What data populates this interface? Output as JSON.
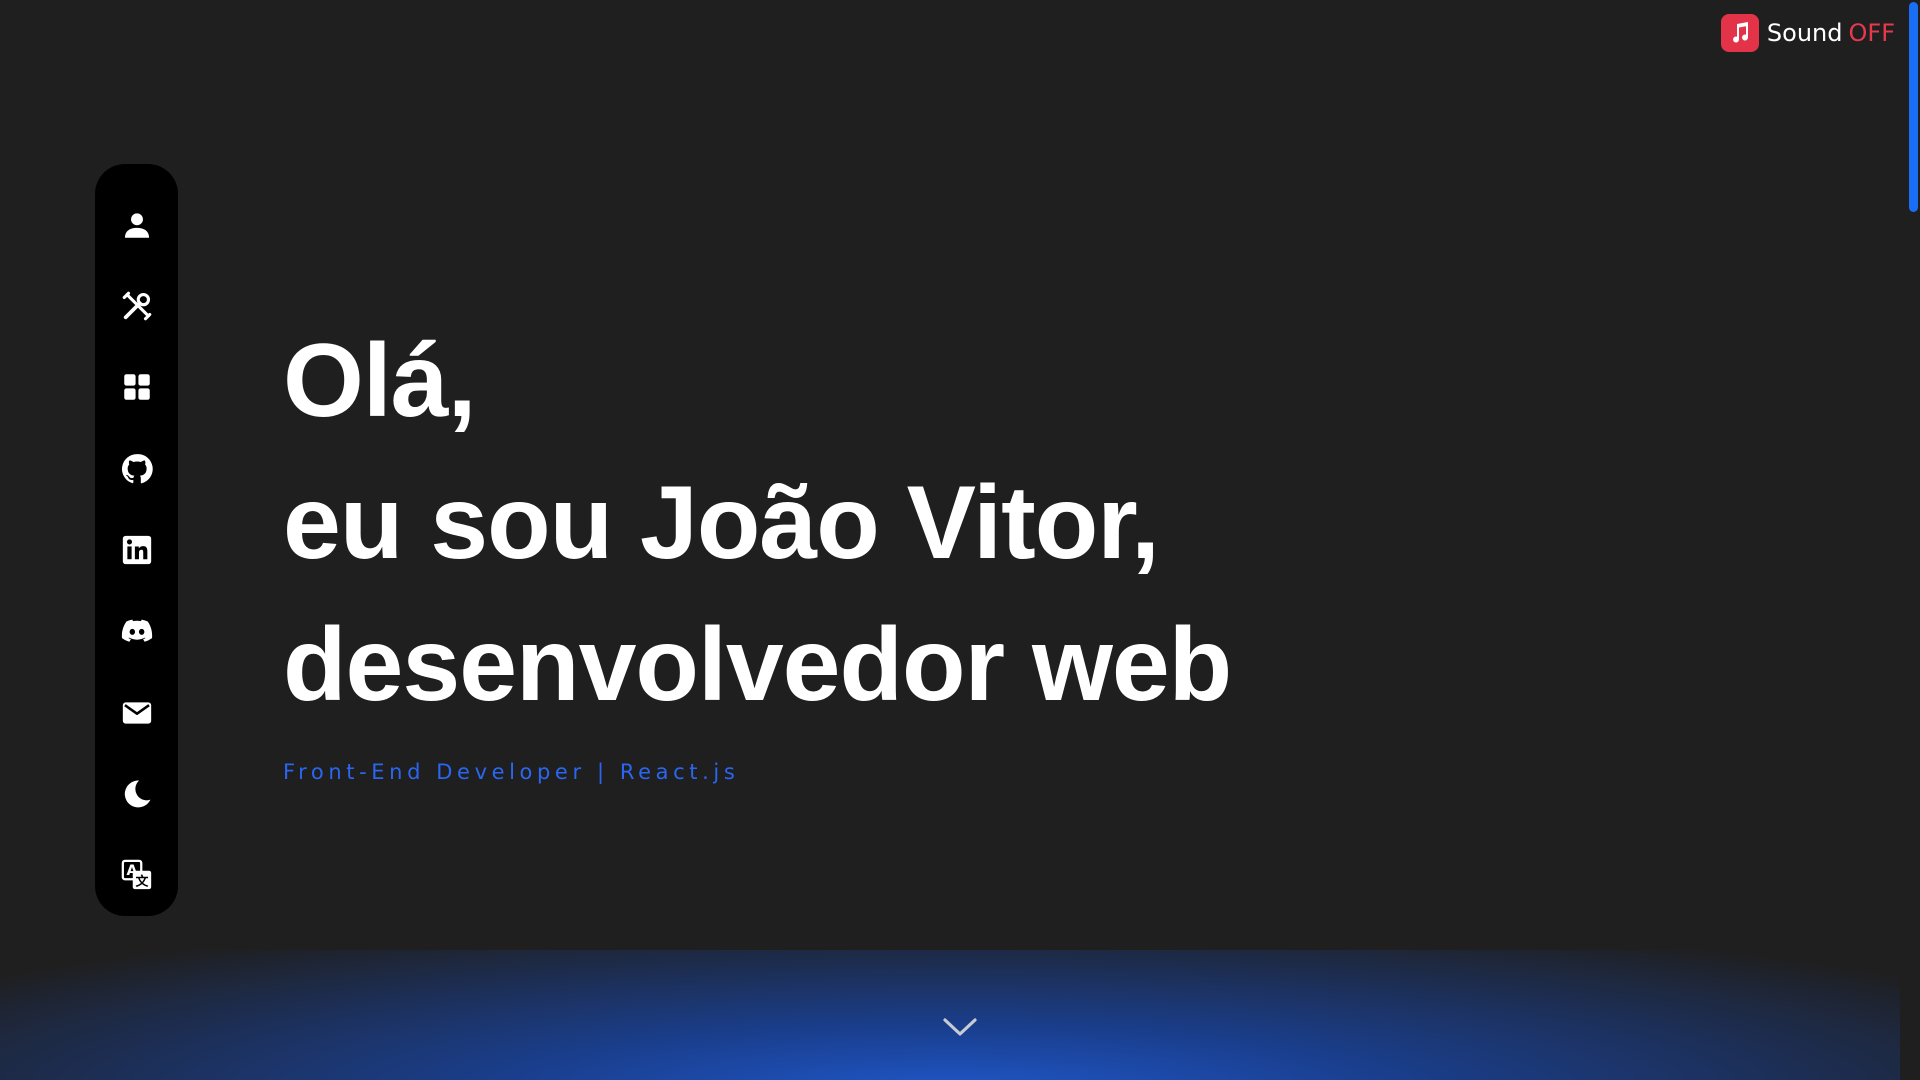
{
  "sound": {
    "label": "Sound",
    "state": "OFF",
    "icon": "music-note-icon",
    "accent": "#e33348"
  },
  "sidebar": {
    "items": [
      {
        "name": "about",
        "icon": "user-icon"
      },
      {
        "name": "skills",
        "icon": "tools-icon"
      },
      {
        "name": "projects",
        "icon": "grid-icon"
      },
      {
        "name": "github",
        "icon": "github-icon"
      },
      {
        "name": "linkedin",
        "icon": "linkedin-icon"
      },
      {
        "name": "discord",
        "icon": "discord-icon"
      },
      {
        "name": "email",
        "icon": "mail-icon"
      },
      {
        "name": "theme",
        "icon": "moon-icon"
      },
      {
        "name": "language",
        "icon": "translate-icon"
      }
    ]
  },
  "hero": {
    "line1": "Olá,",
    "line2": "eu sou João Vitor,",
    "line3": "desenvolvedor web",
    "subtitle": "Front-End Developer | React.js"
  },
  "scroll_hint": {
    "icon": "chevron-down-icon"
  },
  "colors": {
    "background": "#1f1f20",
    "accent": "#2a66f0",
    "sidebar": "#000000",
    "glow": "#1f57c9"
  }
}
